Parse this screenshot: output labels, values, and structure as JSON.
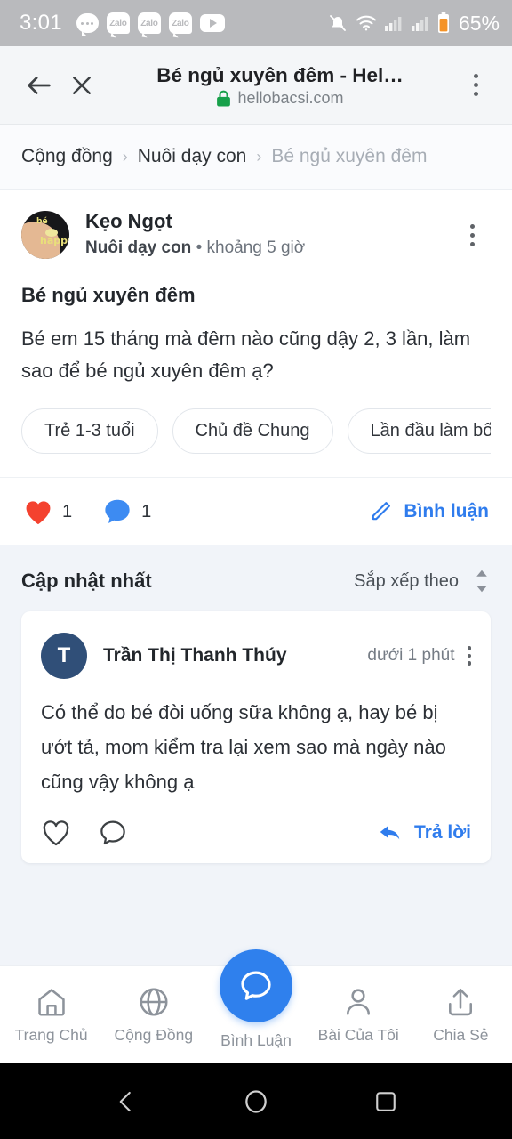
{
  "status_bar": {
    "time": "3:01",
    "battery": "65%",
    "left_icons": [
      "messages-icon",
      "zalo-icon",
      "zalo-icon",
      "zalo-icon",
      "youtube-icon"
    ],
    "right_icons": [
      "bell-muted-icon",
      "wifi-icon",
      "signal-icon",
      "signal-icon",
      "battery-icon"
    ],
    "zalo_label": "Zalo"
  },
  "browser": {
    "title": "Bé ngủ xuyên đêm - Hel…",
    "url": "hellobacsi.com",
    "back_icon": "back-arrow-icon",
    "close_icon": "close-icon",
    "lock_icon": "lock-icon",
    "menu_icon": "kebab-menu-icon"
  },
  "breadcrumb": {
    "items": [
      {
        "label": "Cộng đồng",
        "muted": false
      },
      {
        "label": "Nuôi dạy con",
        "muted": false
      },
      {
        "label": "Bé ngủ xuyên đêm",
        "muted": true
      }
    ],
    "separator": "›"
  },
  "post": {
    "author": "Kẹo Ngọt",
    "category": "Nuôi dạy con",
    "meta_separator": "•",
    "time": "khoảng 5 giờ",
    "title": "Bé ngủ xuyên đêm",
    "body": "Bé em 15 tháng mà đêm nào cũng dậy 2, 3 lần, làm sao để bé ngủ xuyên đêm ạ?",
    "tags": [
      "Trẻ 1-3 tuổi",
      "Chủ đề Chung",
      "Lần đầu làm bố m"
    ],
    "likes": "1",
    "comments": "1",
    "comment_action": "Bình luận"
  },
  "comments_section": {
    "heading": "Cập nhật nhất",
    "sort_label": "Sắp xếp theo",
    "sort_icon": "sort-updown-icon",
    "items": [
      {
        "avatar_initial": "T",
        "author": "Trần Thị Thanh Thúy",
        "time": "dưới 1 phút",
        "body": "Có thể do bé đòi uống sữa không ạ, hay bé bị ướt tả, mom kiểm tra lại xem sao mà ngày nào cũng vậy không ạ",
        "reply_label": "Trả lời"
      }
    ]
  },
  "bottom_nav": {
    "items": [
      {
        "label": "Trang Chủ",
        "icon": "home-icon"
      },
      {
        "label": "Cộng Đồng",
        "icon": "globe-icon"
      },
      {
        "label": "Bình Luận",
        "icon": "chat-bubble-icon"
      },
      {
        "label": "Bài Của Tôi",
        "icon": "person-icon"
      },
      {
        "label": "Chia Sẻ",
        "icon": "share-icon"
      }
    ]
  },
  "android_nav": {
    "back": "android-back-icon",
    "home": "android-home-icon",
    "recents": "android-recents-icon"
  },
  "colors": {
    "accent_blue": "#2f80ed",
    "heart_red": "#f4422f",
    "avatar_blue": "#304f78",
    "lock_green": "#17a04a",
    "statusbar_gray": "#b9babd"
  }
}
